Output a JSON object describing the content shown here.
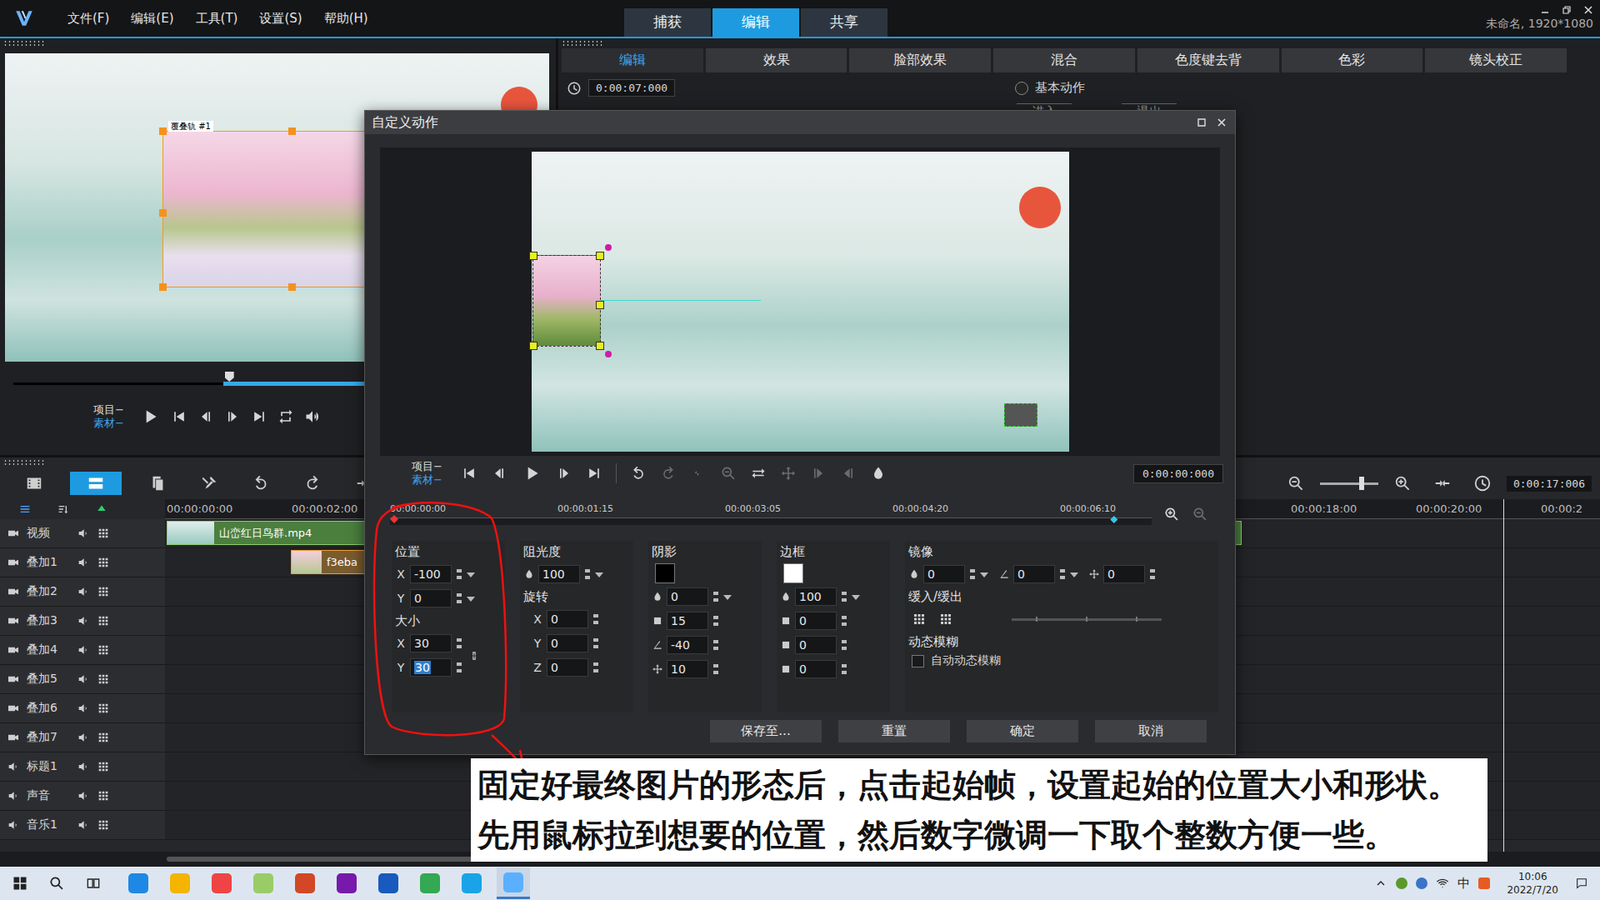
{
  "app": {
    "menu": [
      "文件(F)",
      "编辑(E)",
      "工具(T)",
      "设置(S)",
      "帮助(H)"
    ],
    "mode_tabs": [
      {
        "label": "捕获",
        "selected": false
      },
      {
        "label": "编辑",
        "selected": true
      },
      {
        "label": "共享",
        "selected": false
      }
    ],
    "project_info": "未命名, 1920*1080"
  },
  "player": {
    "track_label": "覆叠轨 #1",
    "scrub_level": 0.41,
    "trim_start": 0.4,
    "trim_end": 0.83,
    "mode_labels": [
      "项目−",
      "素材−"
    ],
    "aspect": "16:9"
  },
  "options": {
    "tabs": [
      {
        "label": "编辑",
        "selected": true
      },
      {
        "label": "效果",
        "selected": false
      },
      {
        "label": "脸部效果",
        "selected": false
      },
      {
        "label": "混合",
        "selected": false
      },
      {
        "label": "色度键去背",
        "selected": false
      },
      {
        "label": "色彩",
        "selected": false
      },
      {
        "label": "镜头校正",
        "selected": false
      }
    ],
    "time": "0:00:07:000",
    "basic_motion": {
      "label": "基本动作",
      "selected": false
    },
    "enter": "进入",
    "exit": "退出"
  },
  "timeline": {
    "ruler": [
      "00:00:00:00",
      "00:00:02:00",
      "00:00:18:00",
      "00:00:20:00",
      "00:00:2"
    ],
    "time": "0:00:17:006",
    "zoom_level": 0.72,
    "tracks": [
      {
        "name": "视频",
        "clip": "山峦红日鸟群.mp4"
      },
      {
        "name": "叠加1",
        "clip": "f3eba"
      },
      {
        "name": "叠加2"
      },
      {
        "name": "叠加3"
      },
      {
        "name": "叠加4"
      },
      {
        "name": "叠加5"
      },
      {
        "name": "叠加6"
      },
      {
        "name": "叠加7"
      },
      {
        "name": "标题1"
      },
      {
        "name": "声音"
      },
      {
        "name": "音乐1"
      }
    ]
  },
  "dialog": {
    "title": "自定义动作",
    "mode_labels": [
      "项目−",
      "素材−"
    ],
    "time": "0:00:00:000",
    "ruler": [
      "00:00:00:00",
      "00:00:01:15",
      "00:00:03:05",
      "00:00:04:20",
      "00:00:06:10"
    ],
    "keyframe_level": 0.95,
    "position": {
      "label": "位置",
      "fields": [
        {
          "axis": "X",
          "value": "-100",
          "focused": false
        },
        {
          "axis": "Y",
          "value": "0",
          "focused": false
        }
      ]
    },
    "size": {
      "label": "大小",
      "linked": true,
      "fields": [
        {
          "axis": "X",
          "value": "30",
          "focused": false
        },
        {
          "axis": "Y",
          "value": "30",
          "focused": true
        }
      ]
    },
    "opacity": {
      "label": "阻光度",
      "value": "100"
    },
    "rotation": {
      "label": "旋转",
      "fields": [
        {
          "axis": "X",
          "value": "0"
        },
        {
          "axis": "Y",
          "value": "0"
        },
        {
          "axis": "Z",
          "value": "0"
        }
      ]
    },
    "shadow": {
      "label": "阴影",
      "color": "#000000",
      "values": [
        "0",
        "15",
        "-40",
        "10"
      ]
    },
    "border": {
      "label": "边框",
      "color": "#ffffff",
      "values": [
        "100",
        "0",
        "0",
        "0"
      ]
    },
    "mirror": {
      "label": "镜像",
      "values": [
        "0",
        "0",
        "0"
      ]
    },
    "ease": {
      "label": "缓入/缓出"
    },
    "motion_blur": {
      "label": "动态模糊",
      "checkbox": {
        "label": "自动动态模糊",
        "checked": false
      }
    },
    "buttons": [
      "保存至...",
      "重置",
      "确定",
      "取消"
    ]
  },
  "caption": "固定好最终图片的形态后，点击起始帧，设置起始的位置大小和形状。先用鼠标拉到想要的位置，然后数字微调一下取个整数方便一些。",
  "taskbar": {
    "ime": "中",
    "time": "10:06",
    "date": "2022/7/20"
  }
}
